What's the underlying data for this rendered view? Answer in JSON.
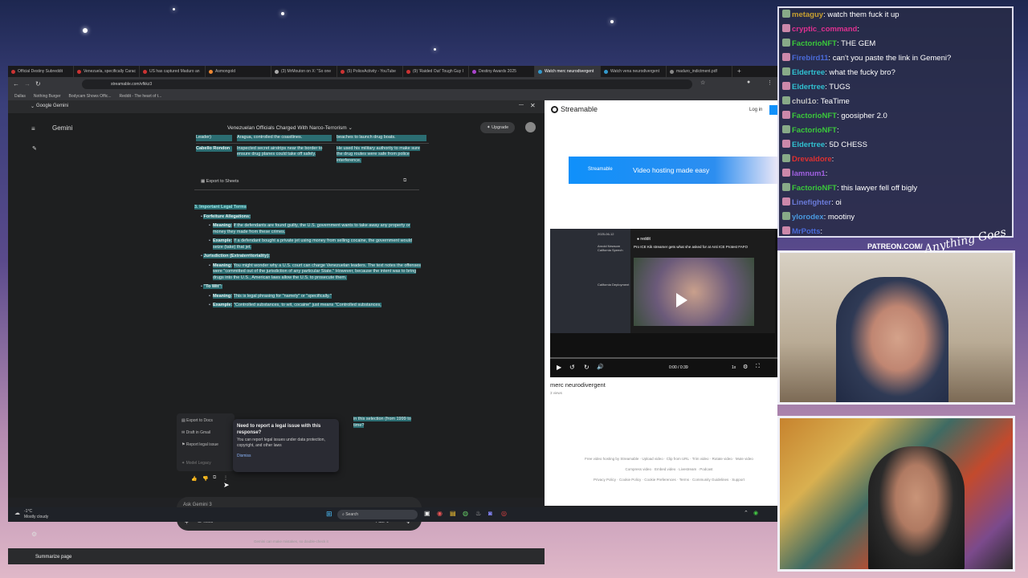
{
  "browser": {
    "tabs": [
      "Official Destiny Subreddit",
      "Venezuela, specifically Carac",
      "US has captured Maduro an",
      "Asmongold",
      "(3) MrMouton on X: \"So one",
      "(5) PoliceActivity - YouTube",
      "(9) 'Raided Out' Tough Guy I",
      "Destiny Awards 2025",
      "Watch merc neurodivergent",
      "Watch vena neurodivergent",
      "maduro_indictment.pdf"
    ],
    "url": "streamable.com/vfkkz3",
    "bookmarks": [
      "Dallas",
      "Nothing Burger",
      "Bodycam Shows Offic...",
      "Reddit - The heart of t..."
    ]
  },
  "gemini": {
    "window_title": "Google Gemini",
    "brand": "Gemini",
    "chat_title": "Venezuelan Officials Charged With Narco-Terrorism",
    "upgrade": "Upgrade",
    "table_rows": [
      {
        "name": "Leader)",
        "desc": "Aragua, controlled the coastlines.",
        "role": "beaches to launch drug boats."
      },
      {
        "name": "Cabello Rondon",
        "desc": "Inspected secret airstrips near the border to ensure drug planes could take off safely.",
        "role": "He used his military authority to make sure the drug routes were safe from police interference."
      }
    ],
    "export_sheets": "Export to Sheets",
    "section_heading": "3. Important Legal Terms",
    "term1": "Forfeiture Allegations:",
    "meaning_label": "Meaning:",
    "example_label": "Example:",
    "term1_meaning": "If the defendants are found guilty, the U.S. government wants to take away any property or money they made from these crimes.",
    "term1_example": "If a defendant bought a private jet using money from selling cocaine, the government would seize (take) that jet.",
    "term2": "Jurisdiction (Extraterritoriality):",
    "term2_meaning": "You might wonder why a U.S. court can charge Venezuelan leaders. The text notes the offenses were \"committed out of the jurisdiction of any particular State.\" However, because the intent was to bring drugs into the U.S., American laws allow the U.S. to prosecute them.",
    "term3": "\"To Wit\":",
    "term3_meaning": "This is legal phrasing for \"namely\" or \"specifically.\"",
    "term3_example": "\"Controlled substances, to wit, cocaine\" just means \"Controlled substances,",
    "partial_text": "in this selection (from 1999 to",
    "partial_text2": "time?",
    "menu": [
      "Export to Docs",
      "Draft in Gmail",
      "Report legal issue",
      "Model Legacy"
    ],
    "popup_title": "Need to report a legal issue with this response?",
    "popup_body": "You can report legal issues under data protection, copyright, and other laws",
    "popup_dismiss": "Dismiss",
    "input_placeholder": "Ask Gemini 3",
    "tools": "Tools",
    "mode": "Fast",
    "disclaimer": "Gemini can make mistakes, so double-check it",
    "summarize": "Summarize page"
  },
  "streamable": {
    "logo": "Streamable",
    "login": "Log in",
    "banner_logo": "Streamable",
    "banner": "Video hosting made easy",
    "video_title": "merc neurodivergent",
    "views": "3 views",
    "time": "0:00 / 0:39",
    "speed": "1x",
    "thumb_date": "2025-06-12",
    "thumb_head1": "Arnold Newsom California Speech",
    "thumb_head2": "California Deployment",
    "thumb_post": "Pro ICE Kik streamer gets what she asked for at Anti ICE Protest FAFO",
    "footer1": [
      "Free video hosting by Streamable",
      "Upload video",
      "Clip from URL",
      "Trim video",
      "Rotate video",
      "Mute video"
    ],
    "footer2": [
      "Compress video",
      "Embed video",
      "Livestream",
      "Podcast"
    ],
    "footer3": [
      "Privacy Policy",
      "Cookie Policy",
      "Cookie Preferences",
      "Terms",
      "Community Guidelines",
      "Support"
    ]
  },
  "taskbar": {
    "weather": "-1°C",
    "weather_desc": "Mostly cloudy",
    "search": "Search"
  },
  "chat": [
    {
      "user": "metaguy",
      "text": "watch them fuck it up",
      "color": "#c8a030"
    },
    {
      "user": "cryptic_command",
      "text": "",
      "color": "#e03090"
    },
    {
      "user": "FactorioNFT",
      "text": "THE GEM",
      "color": "#3ac83a"
    },
    {
      "user": "Firebird11",
      "text": "can't you paste the link in Gemeni?",
      "color": "#4a6ad8"
    },
    {
      "user": "Eldertree",
      "text": "what the fucky bro?",
      "color": "#30c0d0"
    },
    {
      "user": "Eldertree",
      "text": "TUGS",
      "color": "#30c0d0"
    },
    {
      "user": "chul1o",
      "text": "TeaTime",
      "color": "#c0c0c0"
    },
    {
      "user": "FactorioNFT",
      "text": "goosipher 2.0",
      "color": "#3ac83a"
    },
    {
      "user": "FactorioNFT",
      "text": "",
      "color": "#3ac83a"
    },
    {
      "user": "Eldertree",
      "text": "5D CHESS",
      "color": "#30c0d0"
    },
    {
      "user": "Drevaldore",
      "text": "",
      "color": "#e03030"
    },
    {
      "user": "lamnum1",
      "text": "",
      "color": "#a060e0"
    },
    {
      "user": "FactorioNFT",
      "text": "this lawyer fell off bigly",
      "color": "#3ac83a"
    },
    {
      "user": "Linefighter",
      "text": "oi",
      "color": "#6a7ad8"
    },
    {
      "user": "ylorodex",
      "text": "mootiny",
      "color": "#4a9ae0"
    },
    {
      "user": "MrPotts",
      "text": "",
      "color": "#4a6ad8"
    }
  ],
  "overlay": {
    "patreon": "PATREON.COM/",
    "signature": "Anything Goes"
  }
}
